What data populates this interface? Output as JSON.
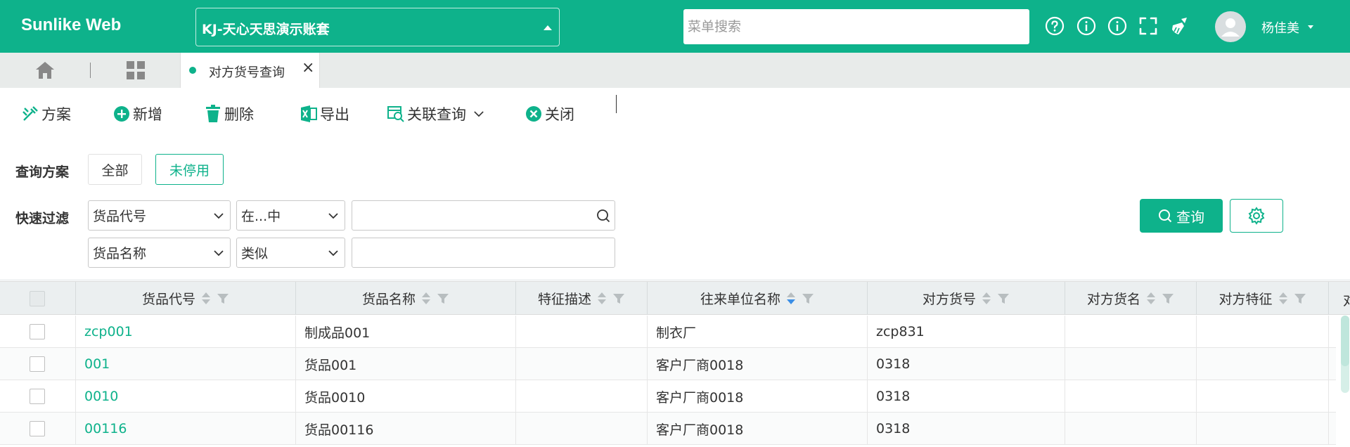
{
  "app": {
    "logo": "Sunlike Web",
    "account": "KJ-天心天思演示账套",
    "menu_search_placeholder": "菜单搜索",
    "user_name": "杨佳美"
  },
  "tabs": [
    {
      "label": "对方货号查询",
      "active": true
    }
  ],
  "toolbar": {
    "plan": "方案",
    "add": "新增",
    "delete": "删除",
    "export": "导出",
    "related_query": "关联查询",
    "close": "关闭"
  },
  "filters": {
    "plan_label": "查询方案",
    "plan_all": "全部",
    "plan_active": "未停用",
    "quick_label": "快速过滤",
    "row1": {
      "field": "货品代号",
      "operator": "在...中",
      "value": ""
    },
    "row2": {
      "field": "货品名称",
      "operator": "类似",
      "value": ""
    },
    "query_button": "查询"
  },
  "table": {
    "columns": [
      "货品代号",
      "货品名称",
      "特征描述",
      "往来单位名称",
      "对方货号",
      "对方货名",
      "对方特征",
      "对"
    ],
    "rows": [
      {
        "code": "zcp001",
        "name": "制成品001",
        "feature": "",
        "partner": "制衣厂",
        "their_code": "zcp831",
        "their_name": "",
        "their_feature": ""
      },
      {
        "code": "001",
        "name": "货品001",
        "feature": "",
        "partner": "客户厂商0018",
        "their_code": "0318",
        "their_name": "",
        "their_feature": ""
      },
      {
        "code": "0010",
        "name": "货品0010",
        "feature": "",
        "partner": "客户厂商0018",
        "their_code": "0318",
        "their_name": "",
        "their_feature": ""
      },
      {
        "code": "00116",
        "name": "货品00116",
        "feature": "",
        "partner": "客户厂商0018",
        "their_code": "0318",
        "their_name": "",
        "their_feature": ""
      }
    ]
  },
  "colors": {
    "brand": "#0eb28b",
    "sort_active": "#3a8ee6"
  },
  "icons": {
    "header": [
      "help-icon",
      "info-icon",
      "info-icon",
      "fullscreen-icon",
      "clean-icon"
    ],
    "toolbar": [
      "plan-icon",
      "add-icon",
      "delete-icon",
      "excel-icon",
      "related-query-icon",
      "close-circle-icon"
    ]
  }
}
